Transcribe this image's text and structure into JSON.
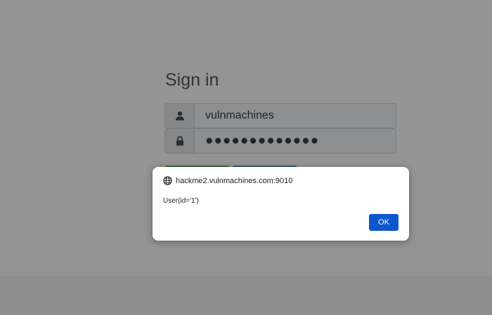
{
  "signin": {
    "title": "Sign in",
    "username_value": "vulnmachines",
    "password_value": "●●●●●●●●●●●●●",
    "username_icon": "user-icon",
    "password_icon": "lock-icon"
  },
  "dialog": {
    "origin": "hackme2.vulnmachines.com:9010",
    "origin_icon": "globe-icon",
    "message": "User(id='1')",
    "ok_label": "OK"
  },
  "colors": {
    "ok_button": "#0b57d0",
    "login_button": "#5cb85c",
    "secondary_button": "#5b9bd5"
  }
}
